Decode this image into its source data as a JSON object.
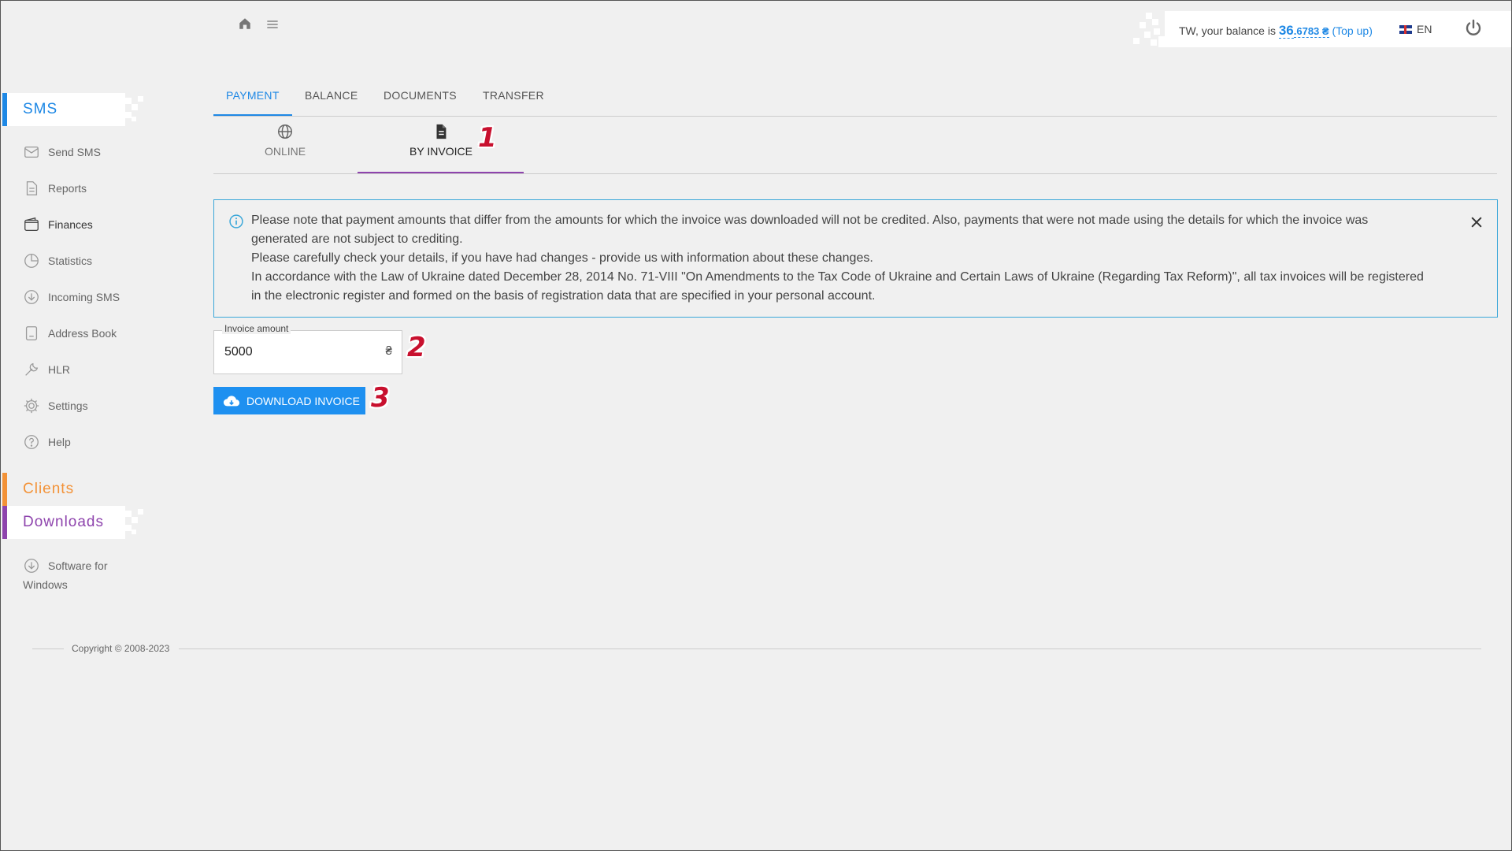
{
  "header": {
    "home_icon": "home-icon",
    "menu_icon": "hamburger-icon",
    "balance_prefix": "TW, your balance is ",
    "balance_int": "36",
    "balance_dec": ".6783 ₴",
    "topup_open": " (",
    "topup_label": "Top up",
    "topup_close": ")",
    "language": "EN",
    "power_icon": "power-icon"
  },
  "sidebar": {
    "sms_title": "SMS",
    "items": [
      {
        "label": "Send SMS",
        "icon": "envelope-icon"
      },
      {
        "label": "Reports",
        "icon": "document-icon"
      },
      {
        "label": "Finances",
        "icon": "wallet-icon"
      },
      {
        "label": "Statistics",
        "icon": "pie-chart-icon"
      },
      {
        "label": "Incoming SMS",
        "icon": "download-circle-icon"
      },
      {
        "label": "Address Book",
        "icon": "address-book-icon"
      },
      {
        "label": "HLR",
        "icon": "wrench-icon"
      },
      {
        "label": "Settings",
        "icon": "gear-icon"
      },
      {
        "label": "Help",
        "icon": "help-icon"
      }
    ],
    "clients_title": "Clients",
    "downloads_title": "Downloads",
    "download_item_line1": "Software for",
    "download_item_line2": "Windows"
  },
  "tabs": [
    "PAYMENT",
    "BALANCE",
    "DOCUMENTS",
    "TRANSFER"
  ],
  "subtabs": [
    "ONLINE",
    "BY INVOICE"
  ],
  "info": {
    "line1": "Please note that payment amounts that differ from the amounts for which the invoice was downloaded will not be credited. Also, payments that were not made using the details for which the invoice was",
    "line2": "generated are not subject to crediting.",
    "line3": "Please carefully check your details, if you have had changes - provide us with information about these changes.",
    "line4": "In accordance with the Law of Ukraine dated December 28, 2014 No. 71-VIII \"On Amendments to the Tax Code of Ukraine and Certain Laws of Ukraine (Regarding Tax Reform)\", all tax invoices will be registered",
    "line5": "in the electronic register and formed on the basis of registration data that are specified in your personal account."
  },
  "invoice": {
    "label": "Invoice amount",
    "value": "5000",
    "currency": "₴",
    "button_label": "DOWNLOAD INVOICE"
  },
  "markers": [
    "1",
    "2",
    "3"
  ],
  "footer": {
    "copyright": "Copyright © 2008-2023"
  },
  "colors": {
    "accent": "#1e88e5",
    "sms_bar": "#1e88e5",
    "clients": "#f39237",
    "downloads": "#8e44ad",
    "subtab_active": "#8e44ad",
    "marker": "#c8102e"
  }
}
